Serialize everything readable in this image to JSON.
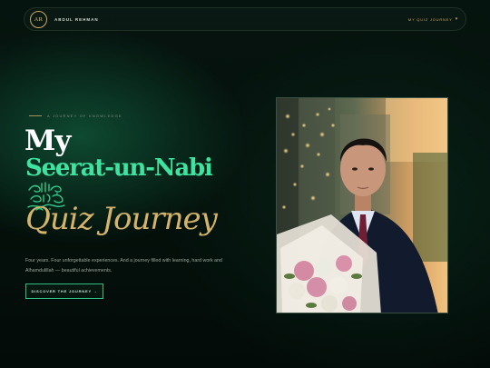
{
  "nav": {
    "logo_initials": "AR",
    "brand_name": "ABDUL REHMAN",
    "link_label": "MY QUIZ JOURNEY",
    "link_caret_icon": "chevron-down-icon"
  },
  "hero": {
    "eyebrow": "A JOURNEY OF KNOWLEDGE",
    "title_line1": "My",
    "title_line2": "Seerat-un-Nabi",
    "calligraphy_text": "صلى الله عليه وسلم",
    "title_line3": "Quiz Journey",
    "description": "Four years. Four unforgettable experiences. And a journey filled with learning, hard work and Alhamdulillah — beautiful achievements.",
    "cta_label": "DISCOVER THE JOURNEY →"
  },
  "colors": {
    "accent_green": "#3ee39f",
    "accent_gold": "#d4b36b",
    "background": "#04100b"
  },
  "photo": {
    "subject": "portrait-photo",
    "icon": "photo-portrait"
  }
}
